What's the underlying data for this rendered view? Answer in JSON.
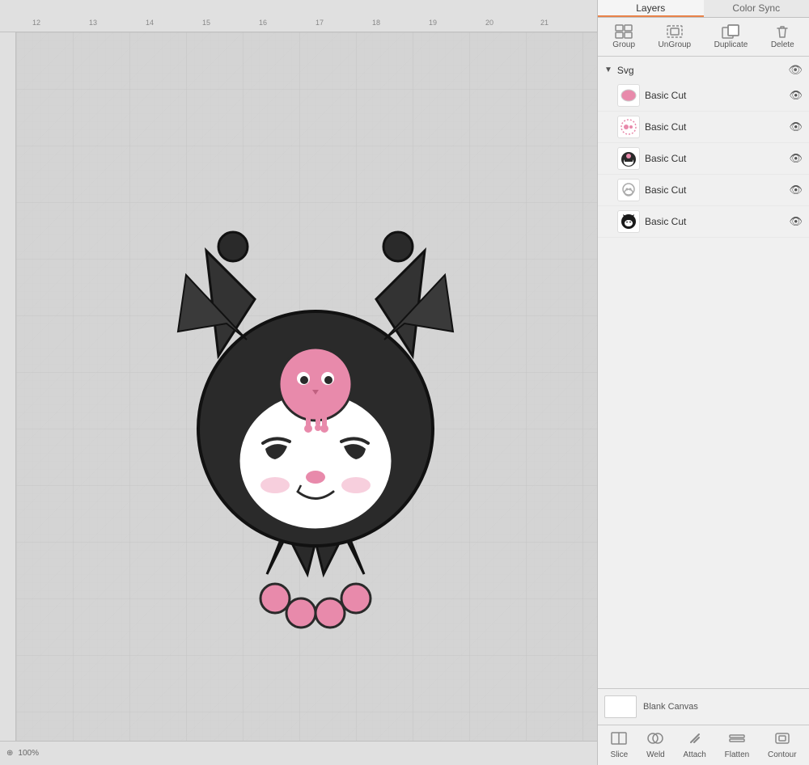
{
  "tabs": {
    "layers": "Layers",
    "colorSync": "Color Sync"
  },
  "toolbar": {
    "group": "Group",
    "ungroup": "UnGroup",
    "duplicate": "Duplicate",
    "delete": "Delete"
  },
  "tree": {
    "parent": "Svg",
    "layers": [
      {
        "id": 1,
        "name": "Basic Cut",
        "thumbnail": "pink-oval",
        "visible": true
      },
      {
        "id": 2,
        "name": "Basic Cut",
        "thumbnail": "pink-dotted",
        "visible": true
      },
      {
        "id": 3,
        "name": "Basic Cut",
        "thumbnail": "kuromi-face",
        "visible": true
      },
      {
        "id": 4,
        "name": "Basic Cut",
        "thumbnail": "ghost-outline",
        "visible": true
      },
      {
        "id": 5,
        "name": "Basic Cut",
        "thumbnail": "kuromi-black",
        "visible": true
      }
    ]
  },
  "bottomPanel": {
    "label": "Blank Canvas"
  },
  "actions": {
    "slice": "Slice",
    "weld": "Weld",
    "attach": "Attach",
    "flatten": "Flatten",
    "contour": "Contour"
  },
  "ruler": {
    "marks": [
      "12",
      "13",
      "14",
      "15",
      "16",
      "17",
      "18",
      "19",
      "20",
      "21"
    ]
  },
  "colors": {
    "tabActive": "#e8834a",
    "panelBg": "#f0f0f0",
    "layerBg": "#ffffff"
  }
}
